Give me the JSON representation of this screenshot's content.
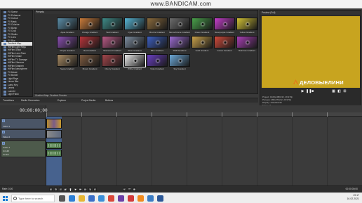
{
  "watermark": "www.BANDICAM.com",
  "fx_list": {
    "items": [
      "FX Scene",
      "FX Enhancer",
      "FX Cutout",
      "FX Mask",
      "FX Colorize",
      "FX Bump",
      "FX Crop",
      "FX Studio",
      "FX Lens",
      "FX Blur",
      "Gradient Map",
      "HitFilm Light Rays",
      "HitFilm Glitch",
      "HitFilm Lens Flare",
      "HitFilm Shake",
      "HitFilm TV Damage",
      "HitFilm Vibrance",
      "HitFilm Sharpen",
      "HitFilm Atmosphere",
      "FX Abuse",
      "FX Border",
      "Light Rays",
      "Linear Blur",
      "Luma Key",
      "Levels",
      "Lumetri",
      "Light Flash",
      "Mosaic",
      "Mask",
      "Noise"
    ],
    "selected_index": 10
  },
  "presets": {
    "title": "Presets",
    "items": [
      {
        "label": "Aqua Gradient",
        "color": "#5b8ea8"
      },
      {
        "label": "Orange Gradient",
        "color": "#c77a39"
      },
      {
        "label": "Teal Gradient",
        "color": "#3e8b88"
      },
      {
        "label": "Cyan Gradient",
        "color": "#56b4d4"
      },
      {
        "label": "Bronze Gradient",
        "color": "#8a6a3c"
      },
      {
        "label": "Monochrome Gradient",
        "color": "#6c6c6c"
      },
      {
        "label": "Green Gradient",
        "color": "#49a04a"
      },
      {
        "label": "Neonpurple Gradient",
        "color": "#c43ecb"
      },
      {
        "label": "Yellow Gradient",
        "color": "#d0c034"
      },
      {
        "label": "Purple Gradient",
        "color": "#8a4fb0"
      },
      {
        "label": "Red Gradient",
        "color": "#b8343a"
      },
      {
        "label": "Sherwood Gradient",
        "color": "#b95a86"
      },
      {
        "label": "Slate Gradient",
        "color": "#7c8c9e"
      },
      {
        "label": "Blue Gradient",
        "color": "#3d5fc0"
      },
      {
        "label": "RGB Gradient",
        "color": "#9a6ad0"
      },
      {
        "label": "Gold Gradient",
        "color": "#c9a14a"
      },
      {
        "label": "Colour Gradient",
        "color": "#d04a3a"
      },
      {
        "label": "Rainbow Gradient",
        "color": "#a83fb5"
      },
      {
        "label": "Sepia Gradient",
        "color": "#a88b63"
      },
      {
        "label": "Brown Gradient",
        "color": "#7d5a3f"
      },
      {
        "label": "Cherry Gradient",
        "color": "#a3464b"
      },
      {
        "label": "White Gradient",
        "color": "#e8e8e8"
      },
      {
        "label": "Violet Gradient",
        "color": "#6a3fc2"
      },
      {
        "label": "Sky Gradient",
        "color": "#6ca8d8"
      }
    ],
    "selected_index": 21
  },
  "status_line": "Gradient Map: Gradient Presets",
  "tabs": [
    "Transitions",
    "Media Generators",
    "Explorer",
    "Project Media",
    "Buttons"
  ],
  "preview": {
    "toolbar": "Preview (Full)",
    "brand_text": "ДЕЛОВЫЕЛИНИ",
    "info": [
      "Project: 1920x1080x32, 29.970p",
      "Preview: 480x270x32, 29.970p",
      "Display: 342x192x32"
    ],
    "frame_label": "Frame:",
    "frame_value": "0"
  },
  "timeline": {
    "timecode": "00:00:00;00",
    "tracks": [
      {
        "name": "Video 1",
        "num": "1"
      },
      {
        "name": "Video 2",
        "num": "2"
      },
      {
        "name": "Audio 1",
        "num": "3"
      }
    ],
    "audio_level": "0.0 dB",
    "pan_label": "Center",
    "rate": "Rate: 0.00",
    "end_timecode": "00:00:00;00"
  },
  "taskbar": {
    "search_placeholder": "Type here to search",
    "time": "19:17",
    "date": "16.02.2021",
    "icons": [
      {
        "name": "task-view-icon",
        "color": "#555555"
      },
      {
        "name": "edge-icon",
        "color": "#2c7fd6"
      },
      {
        "name": "explorer-icon",
        "color": "#e6b634"
      },
      {
        "name": "store-icon",
        "color": "#3a6fc8"
      },
      {
        "name": "mail-icon",
        "color": "#3b8fd8"
      },
      {
        "name": "chrome-icon",
        "color": "#d9473a"
      },
      {
        "name": "vegas-icon",
        "color": "#6b3fa6"
      },
      {
        "name": "bandicam-icon",
        "color": "#d23a3a"
      },
      {
        "name": "vlc-icon",
        "color": "#f08a1e"
      },
      {
        "name": "photos-icon",
        "color": "#3a7cc4"
      },
      {
        "name": "word-icon",
        "color": "#2b5797"
      }
    ]
  }
}
